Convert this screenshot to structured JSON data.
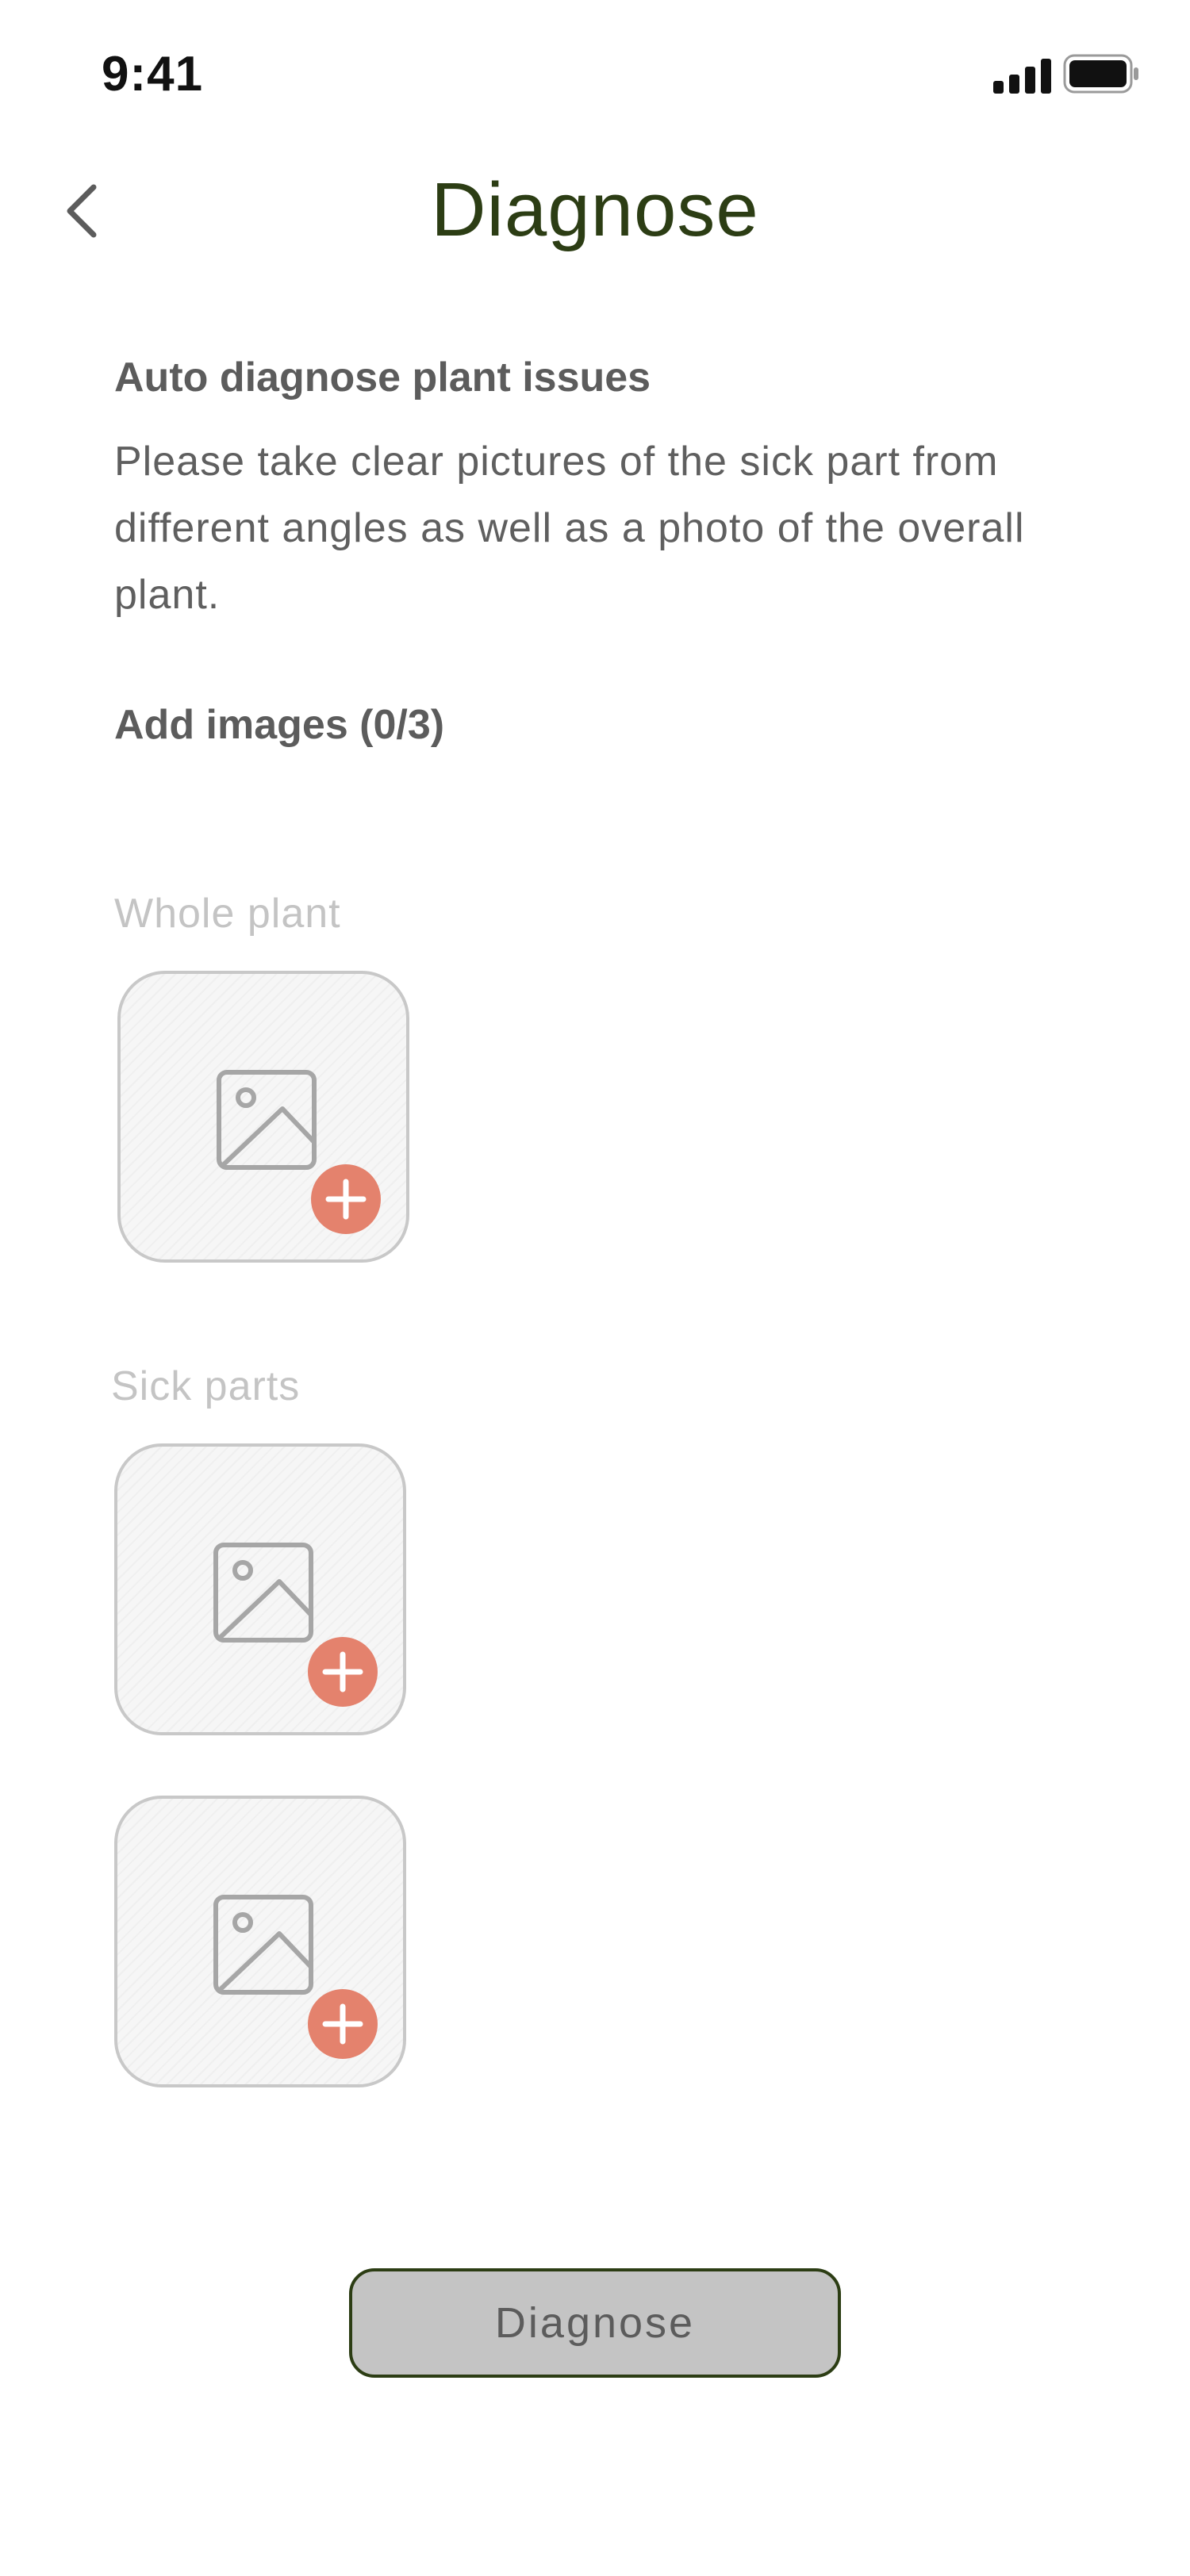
{
  "status_bar": {
    "time": "9:41",
    "signal_icon": "cellular-signal-icon",
    "battery_icon": "battery-icon"
  },
  "header": {
    "title": "Diagnose",
    "back_icon": "chevron-left-icon"
  },
  "intro": {
    "heading": "Auto diagnose plant issues",
    "text": "Please take clear pictures of the sick part from different angles as well as a photo of the overall plant."
  },
  "add_images": {
    "heading": "Add images (0/3)",
    "whole_plant_label": "Whole plant",
    "sick_parts_label": "Sick parts",
    "slot_icon": "image-placeholder-icon",
    "add_icon": "plus-circle-icon"
  },
  "actions": {
    "diagnose_label": "Diagnose"
  },
  "colors": {
    "title": "#2c3d14",
    "accent_add": "#e4826d",
    "button_fill": "#c4c4c4",
    "button_border": "#2c3d14",
    "muted_label": "#c4c4c4"
  }
}
